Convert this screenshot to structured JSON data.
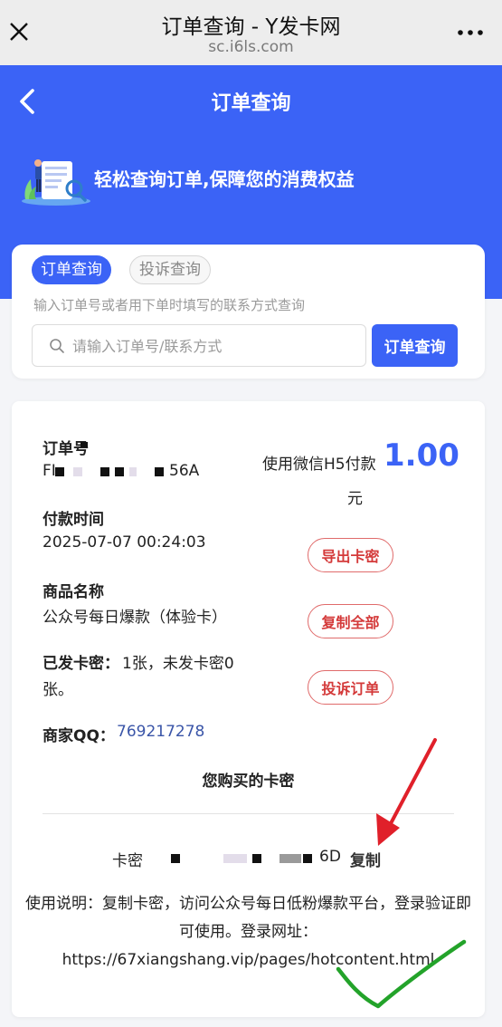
{
  "topbar": {
    "title": "订单查询 - Y发卡网",
    "domain": "sc.i6ls.com",
    "close_icon": "close-icon",
    "more_icon": "more-dots-icon"
  },
  "header": {
    "title": "订单查询",
    "slogan": "轻松查询订单,保障您的消费权益",
    "brand_color": "#3b63f6"
  },
  "search": {
    "tabs": [
      {
        "label": "订单查询",
        "active": true
      },
      {
        "label": "投诉查询",
        "active": false
      }
    ],
    "hint": "输入订单号或者用下单时填写的联系方式查询",
    "placeholder": "请输入订单号/联系方式",
    "button": "订单查询"
  },
  "order": {
    "order_no_label": "订单号",
    "order_no_prefix": "FI",
    "order_no_suffix": "56A",
    "pay_method": "使用微信H5付款",
    "amount": "1.00",
    "unit": "元",
    "pay_time_label": "付款时间",
    "pay_time": "2025-07-07 00:24:03",
    "product_label": "商品名称",
    "product": "公众号每日爆款（体验卡）",
    "issued_label": "已发卡密：",
    "issued_line1": "1张，未发卡密0",
    "issued_line2": "张。",
    "qq_label": "商家QQ：",
    "qq": "769217278",
    "actions": {
      "export": "导出卡密",
      "copy_all": "复制全部",
      "complain": "投诉订单"
    },
    "accent_red": "#d43a3a"
  },
  "card_keys": {
    "title": "您购买的卡密",
    "key_label": "卡密",
    "key_tail": "6D",
    "copy": "复制",
    "usage_line1": "使用说明：复制卡密，访问公众号每日低粉爆款平台，登录验证即",
    "usage_line2": "可使用。登录网址：",
    "usage_line3": "https://67xiangshang.vip/pages/hotcontent.html"
  }
}
